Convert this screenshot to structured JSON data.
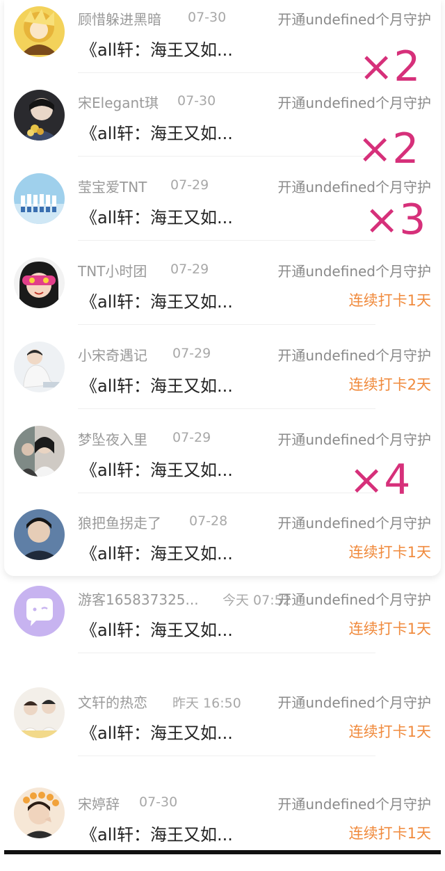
{
  "items": [
    {
      "name": "顾惜躲进黑暗",
      "date": "07-30",
      "action": "开通undefined个月守护",
      "title": "《all轩：海王又如...",
      "streak": "",
      "avatar": "yellow-anime-avatar"
    },
    {
      "name": "宋Elegant琪",
      "date": "07-30",
      "action": "开通undefined个月守护",
      "title": "《all轩：海王又如...",
      "streak": "",
      "avatar": "portrait-with-flowers-avatar"
    },
    {
      "name": "莹宝爱TNT",
      "date": "07-29",
      "action": "开通undefined个月守护",
      "title": "《all轩：海王又如...",
      "streak": "",
      "avatar": "group-photo-avatar"
    },
    {
      "name": "TNT小时团",
      "date": "07-29",
      "action": "开通undefined个月守护",
      "title": "《all轩：海王又如...",
      "streak": "连续打卡1天",
      "avatar": "cartoon-girl-avatar"
    },
    {
      "name": "小宋奇遇记",
      "date": "07-29",
      "action": "开通undefined个月守护",
      "title": "《all轩：海王又如...",
      "streak": "连续打卡2天",
      "avatar": "seated-boy-avatar"
    },
    {
      "name": "梦坠夜入里",
      "date": "07-29",
      "action": "开通undefined个月守护",
      "title": "《all轩：海王又如...",
      "streak": "",
      "avatar": "two-people-avatar"
    },
    {
      "name": "狼把鱼拐走了",
      "date": "07-28",
      "action": "开通undefined个月守护",
      "title": "《all轩：海王又如...",
      "streak": "连续打卡1天",
      "avatar": "boy-portrait-avatar"
    },
    {
      "name": "游客165837325...",
      "date": "今天 07:52",
      "action": "开通undefined个月守护",
      "title": "《all轩：海王又如...",
      "streak": "连续打卡1天",
      "avatar": "default-chat-avatar"
    },
    {
      "name": "文轩的热恋",
      "date": "昨天 16:50",
      "action": "开通undefined个月守护",
      "title": "《all轩：海王又如...",
      "streak": "连续打卡1天",
      "avatar": "pair-photo-avatar"
    },
    {
      "name": "宋婷辞",
      "date": "07-30",
      "action": "开通undefined个月守护",
      "title": "《all轩：海王又如...",
      "streak": "连续打卡1天",
      "avatar": "flower-crown-avatar"
    }
  ],
  "annotations": [
    "×2",
    "×2",
    "×3",
    "×4"
  ],
  "colors": {
    "accent": "#d6307a",
    "streak": "#f08a3c"
  }
}
